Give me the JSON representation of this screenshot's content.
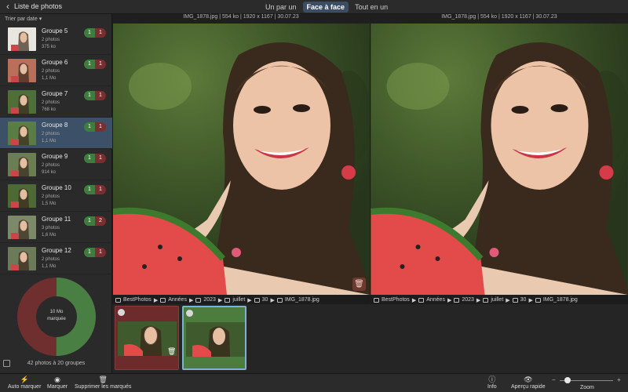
{
  "header": {
    "back_label": "Liste de photos",
    "modes": [
      "Un par un",
      "Face à face",
      "Tout en un"
    ],
    "active_mode": 1
  },
  "sidebar": {
    "sort_label": "Trier par date",
    "groups": [
      {
        "name": "Groupe 5",
        "photos": "2 photos",
        "size": "375 ko",
        "green": "1",
        "red": "1"
      },
      {
        "name": "Groupe 6",
        "photos": "2 photos",
        "size": "1,1 Mo",
        "green": "1",
        "red": "1"
      },
      {
        "name": "Groupe 7",
        "photos": "2 photos",
        "size": "768 ko",
        "green": "1",
        "red": "1"
      },
      {
        "name": "Groupe 8",
        "photos": "2 photos",
        "size": "1,1 Mo",
        "green": "1",
        "red": "1"
      },
      {
        "name": "Groupe 9",
        "photos": "2 photos",
        "size": "914 ko",
        "green": "1",
        "red": "1"
      },
      {
        "name": "Groupe 10",
        "photos": "2 photos",
        "size": "1,5 Mo",
        "green": "1",
        "red": "1"
      },
      {
        "name": "Groupe 11",
        "photos": "3 photos",
        "size": "1,6 Mo",
        "green": "1",
        "red": "2"
      },
      {
        "name": "Groupe 12",
        "photos": "2 photos",
        "size": "1,1 Mo",
        "green": "1",
        "red": "1"
      }
    ],
    "selected_group": 3,
    "donut": {
      "size_label": "10 Mo",
      "marked_label": "marquée",
      "green_fraction": 0.5,
      "green": "#4a7f44",
      "red": "#6f2f2f"
    },
    "footer": "42 photos à 20 groupes"
  },
  "viewers": {
    "left": {
      "info": "IMG_1878.jpg | 554 ko | 1920 x 1167 | 30.07.23",
      "path": [
        "BestPhotos",
        "Années",
        "2023",
        "juillet",
        "30",
        "IMG_1878.jpg"
      ]
    },
    "right": {
      "info": "IMG_1878.jpg | 554 ko | 1920 x 1167 | 30.07.23",
      "path": [
        "BestPhotos",
        "Années",
        "2023",
        "juillet",
        "30",
        "IMG_1878.jpg"
      ]
    }
  },
  "toolbar": {
    "auto_mark": "Auto marquer",
    "mark": "Marquer",
    "delete_marked": "Supprimer les marqués",
    "info": "Info",
    "preview": "Aperçu rapide",
    "zoom": "Zoom",
    "zoom_minus": "−",
    "zoom_plus": "+",
    "zoom_level": 0.15
  }
}
